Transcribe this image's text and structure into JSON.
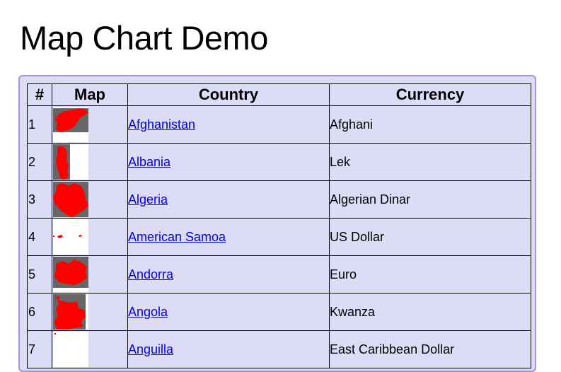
{
  "page": {
    "title": "Map Chart Demo"
  },
  "table": {
    "headers": {
      "num": "#",
      "map": "Map",
      "country": "Country",
      "currency": "Currency"
    },
    "rows": [
      {
        "num": "1",
        "country": "Afghanistan",
        "currency": "Afghani",
        "map_icon": "afghanistan-map-icon"
      },
      {
        "num": "2",
        "country": "Albania",
        "currency": "Lek",
        "map_icon": "albania-map-icon"
      },
      {
        "num": "3",
        "country": "Algeria",
        "currency": "Algerian Dinar",
        "map_icon": "algeria-map-icon"
      },
      {
        "num": "4",
        "country": "American Samoa",
        "currency": "US Dollar",
        "map_icon": "american-samoa-map-icon"
      },
      {
        "num": "5",
        "country": "Andorra",
        "currency": "Euro",
        "map_icon": "andorra-map-icon"
      },
      {
        "num": "6",
        "country": "Angola",
        "currency": "Kwanza",
        "map_icon": "angola-map-icon"
      },
      {
        "num": "7",
        "country": "Anguilla",
        "currency": "East Caribbean Dollar",
        "map_icon": "anguilla-map-icon"
      }
    ]
  },
  "colors": {
    "panel_bg": "#dcdcf6",
    "panel_border": "#9a9ad6",
    "link": "#0000ee",
    "map_fill": "#ff0000",
    "map_bg": "#666666"
  }
}
